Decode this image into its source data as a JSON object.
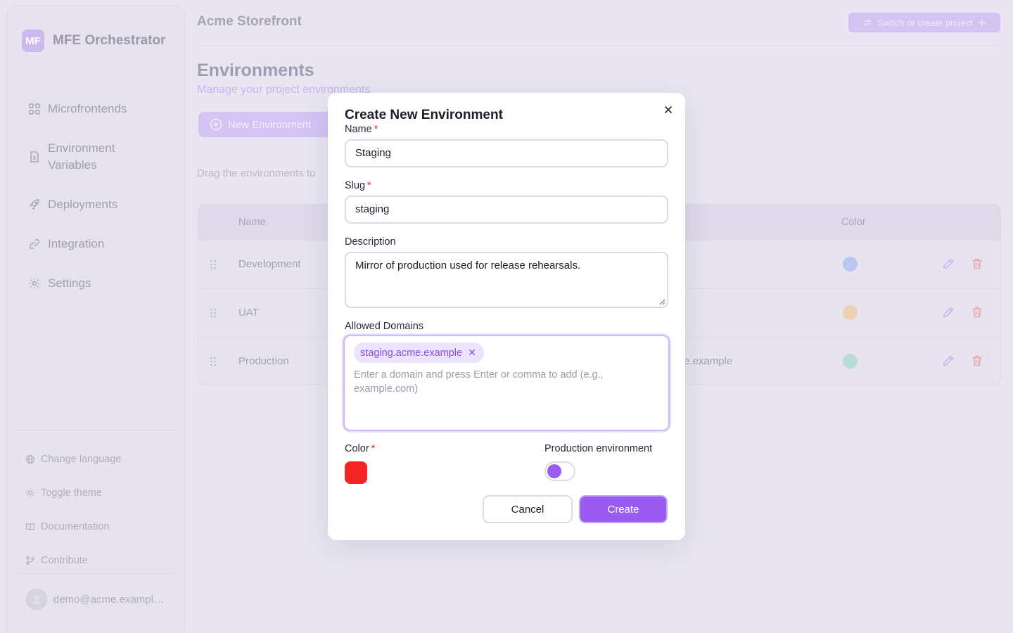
{
  "sidebar": {
    "brand": {
      "logo": "MF",
      "name": "MFE Orchestrator"
    },
    "nav": [
      {
        "label": "Microfrontends",
        "icon": "grid-icon"
      },
      {
        "label": "Environment Variables",
        "icon": "file-icon"
      },
      {
        "label": "Deployments",
        "icon": "rocket-icon"
      },
      {
        "label": "Integration",
        "icon": "link-icon"
      },
      {
        "label": "Settings",
        "icon": "gear-icon"
      }
    ],
    "utilities": [
      {
        "label": "Change language",
        "icon": "globe-icon"
      },
      {
        "label": "Toggle theme",
        "icon": "sun-icon"
      },
      {
        "label": "Documentation",
        "icon": "book-icon"
      },
      {
        "label": "Contribute",
        "icon": "git-branch-icon"
      }
    ],
    "user_email": "demo@acme.example.com"
  },
  "header": {
    "project_name": "Acme Storefront",
    "switch_label": "Switch or create project"
  },
  "page": {
    "title": "Environments",
    "subtitle": "Manage your project environments",
    "new_button": "New Environment",
    "drag_hint": "Drag the environments to"
  },
  "table": {
    "headers": {
      "name": "Name",
      "color": "Color"
    },
    "rows": [
      {
        "name": "Development",
        "domain": "",
        "color": "#b8c6f2"
      },
      {
        "name": "UAT",
        "domain": "",
        "color": "#ecd1b4"
      },
      {
        "name": "Production",
        "domain": "e.example",
        "color": "#b9ddd6"
      }
    ]
  },
  "modal": {
    "title": "Create New Environment",
    "name_label": "Name",
    "name_value": "Staging",
    "slug_label": "Slug",
    "slug_value": "staging",
    "description_label": "Description",
    "description_value": "Mirror of production used for release rehearsals.",
    "domains_label": "Allowed Domains",
    "domains": [
      "staging.acme.example"
    ],
    "domains_placeholder": "Enter a domain and press Enter or comma to add (e.g., example.com)",
    "color_label": "Color",
    "color_value": "#f42424",
    "production_label": "Production environment",
    "production_enabled": true,
    "required_mark": "*",
    "cancel_label": "Cancel",
    "create_label": "Create"
  },
  "colors": {
    "accent": "#9a5cf0",
    "danger": "#e03434"
  }
}
